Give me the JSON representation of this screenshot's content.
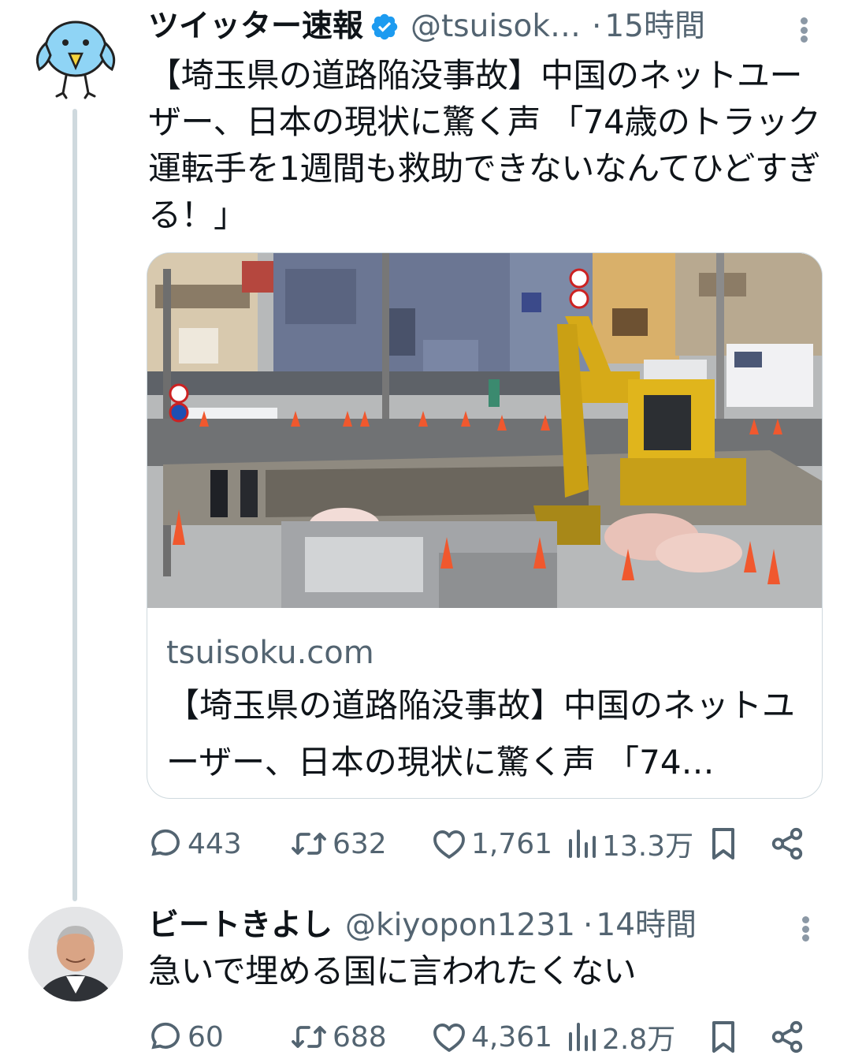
{
  "tweet1": {
    "display_name": "ツイッター速報",
    "handle": "@tsuisok…",
    "separator": "·",
    "time": "15時間",
    "text": "【埼玉県の道路陥没事故】中国のネットユーザー、日本の現状に驚く声 「74歳のトラック運転手を1週間も救助できないなんてひどすぎる！」",
    "card": {
      "domain": "tsuisoku.com",
      "title": "【埼玉県の道路陥没事故】中国のネットユーザー、日本の現状に驚く声 「74…"
    },
    "actions": {
      "replies": "443",
      "retweets": "632",
      "likes": "1,761",
      "views": "13.3万"
    }
  },
  "tweet2": {
    "display_name": "ビートきよし",
    "handle": "@kiyopon1231",
    "separator": "·",
    "time": "14時間",
    "text": "急いで埋める国に言われたくない",
    "actions": {
      "replies": "60",
      "retweets": "688",
      "likes": "4,361",
      "views": "2.8万"
    }
  },
  "icons": {
    "reply": "speech-bubble-icon",
    "retweet": "retweet-arrows-icon",
    "like": "heart-icon",
    "views": "bar-chart-icon",
    "bookmark": "bookmark-icon",
    "share": "share-nodes-icon",
    "verified": "verified-badge-icon",
    "more": "vertical-dots-icon"
  },
  "colors": {
    "verified_blue": "#1d9bf0",
    "text_primary": "#0f1419",
    "text_secondary": "#536471",
    "bird_avatar": "#8fd4f5"
  }
}
